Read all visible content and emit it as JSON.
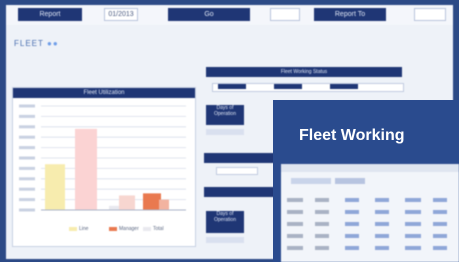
{
  "toolbar": {
    "buttons": [
      "Report",
      "",
      "Go",
      "",
      "Report To",
      ""
    ],
    "field_value": "01/2013"
  },
  "logo_text": "FLEET",
  "chart_panel": {
    "title": "Fleet Utilization",
    "y_ticks": [
      "",
      "",
      "",
      "",
      "",
      "",
      "",
      "",
      "",
      ""
    ]
  },
  "chart_data": {
    "type": "bar",
    "categories": [
      "",
      "",
      "",
      "",
      "",
      ""
    ],
    "values": [
      44,
      78,
      4,
      14,
      16,
      10
    ],
    "ylim": [
      0,
      100
    ],
    "colors": [
      "#f7ecae",
      "#fbd3d3",
      "#e9e9ef",
      "#f7d6d0",
      "#e9794f",
      "#f2b3a0"
    ],
    "legend": [
      "Line",
      "Manager",
      "Total"
    ]
  },
  "right_panel": {
    "strip_title": "Fleet Working Status",
    "sub_title": "",
    "mini_labels": [
      "Days of Operation",
      "Days of Operation"
    ]
  },
  "fleet_card": {
    "title": "Fleet Working"
  },
  "colors": {
    "frame": "#2c4a86",
    "header": "#1f3675",
    "canvas": "#eef2f8",
    "accent_text": "#ffffff"
  }
}
